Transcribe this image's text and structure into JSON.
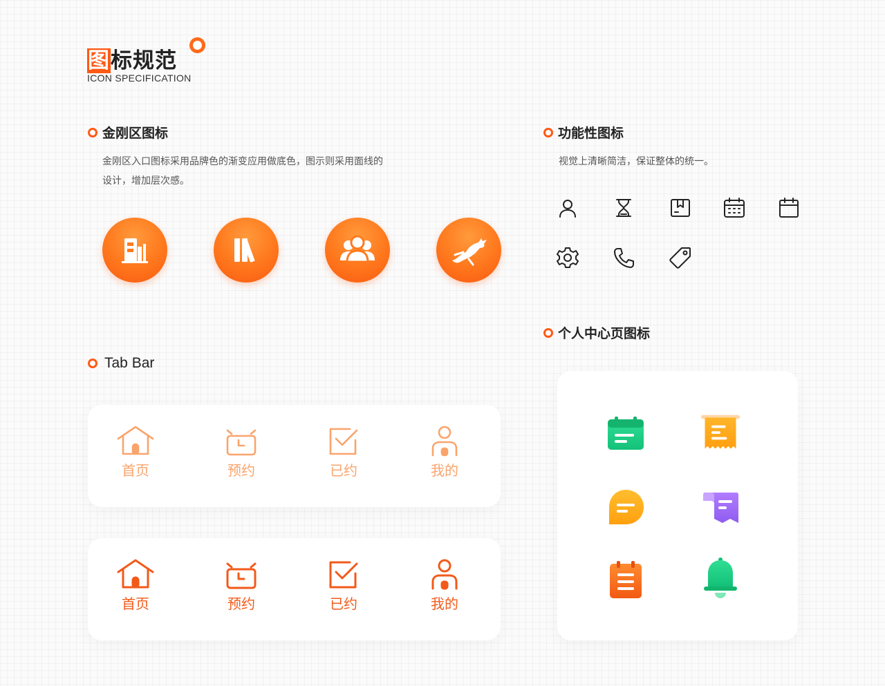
{
  "header": {
    "title_highlight": "图",
    "title_rest": "标规范",
    "subtitle": "ICON SPECIFICATION"
  },
  "sections": {
    "kingkong": {
      "title": "金刚区图标",
      "desc_line1": "金刚区入口图标采用品牌色的渐变应用做底色，图示则采用面线的",
      "desc_line2": "设计，增加层次感。",
      "icons": [
        "building-icon",
        "books-icon",
        "group-icon",
        "deer-icon"
      ]
    },
    "functional": {
      "title": "功能性图标",
      "desc": "视觉上清晰简洁，保证整体的统一。",
      "icons": [
        "user-icon",
        "hourglass-icon",
        "box-icon",
        "calendar-grid-icon",
        "calendar-icon",
        "gear-icon",
        "phone-icon",
        "tag-icon"
      ]
    },
    "personal": {
      "title": "个人中心页图标",
      "icons": [
        "calendar-card-icon",
        "receipt-icon",
        "chat-bubble-icon",
        "ribbon-message-icon",
        "notepad-icon",
        "bell-icon"
      ]
    },
    "tabbar": {
      "title": "Tab Bar",
      "light": [
        {
          "label": "首页",
          "icon": "home-icon"
        },
        {
          "label": "预约",
          "icon": "alarm-clock-icon"
        },
        {
          "label": "已约",
          "icon": "checkbox-icon"
        },
        {
          "label": "我的",
          "icon": "profile-icon"
        }
      ],
      "active": [
        {
          "label": "首页",
          "icon": "home-icon"
        },
        {
          "label": "预约",
          "icon": "alarm-clock-icon"
        },
        {
          "label": "已约",
          "icon": "checkbox-icon"
        },
        {
          "label": "我的",
          "icon": "profile-icon"
        }
      ]
    }
  },
  "colors": {
    "brand": "#ff5a14",
    "tab_light": "#f9a46c",
    "tab_active": "#f25a1a",
    "green": "#1fcf86",
    "yellow": "#ffb020",
    "purple": "#a16cf5"
  }
}
